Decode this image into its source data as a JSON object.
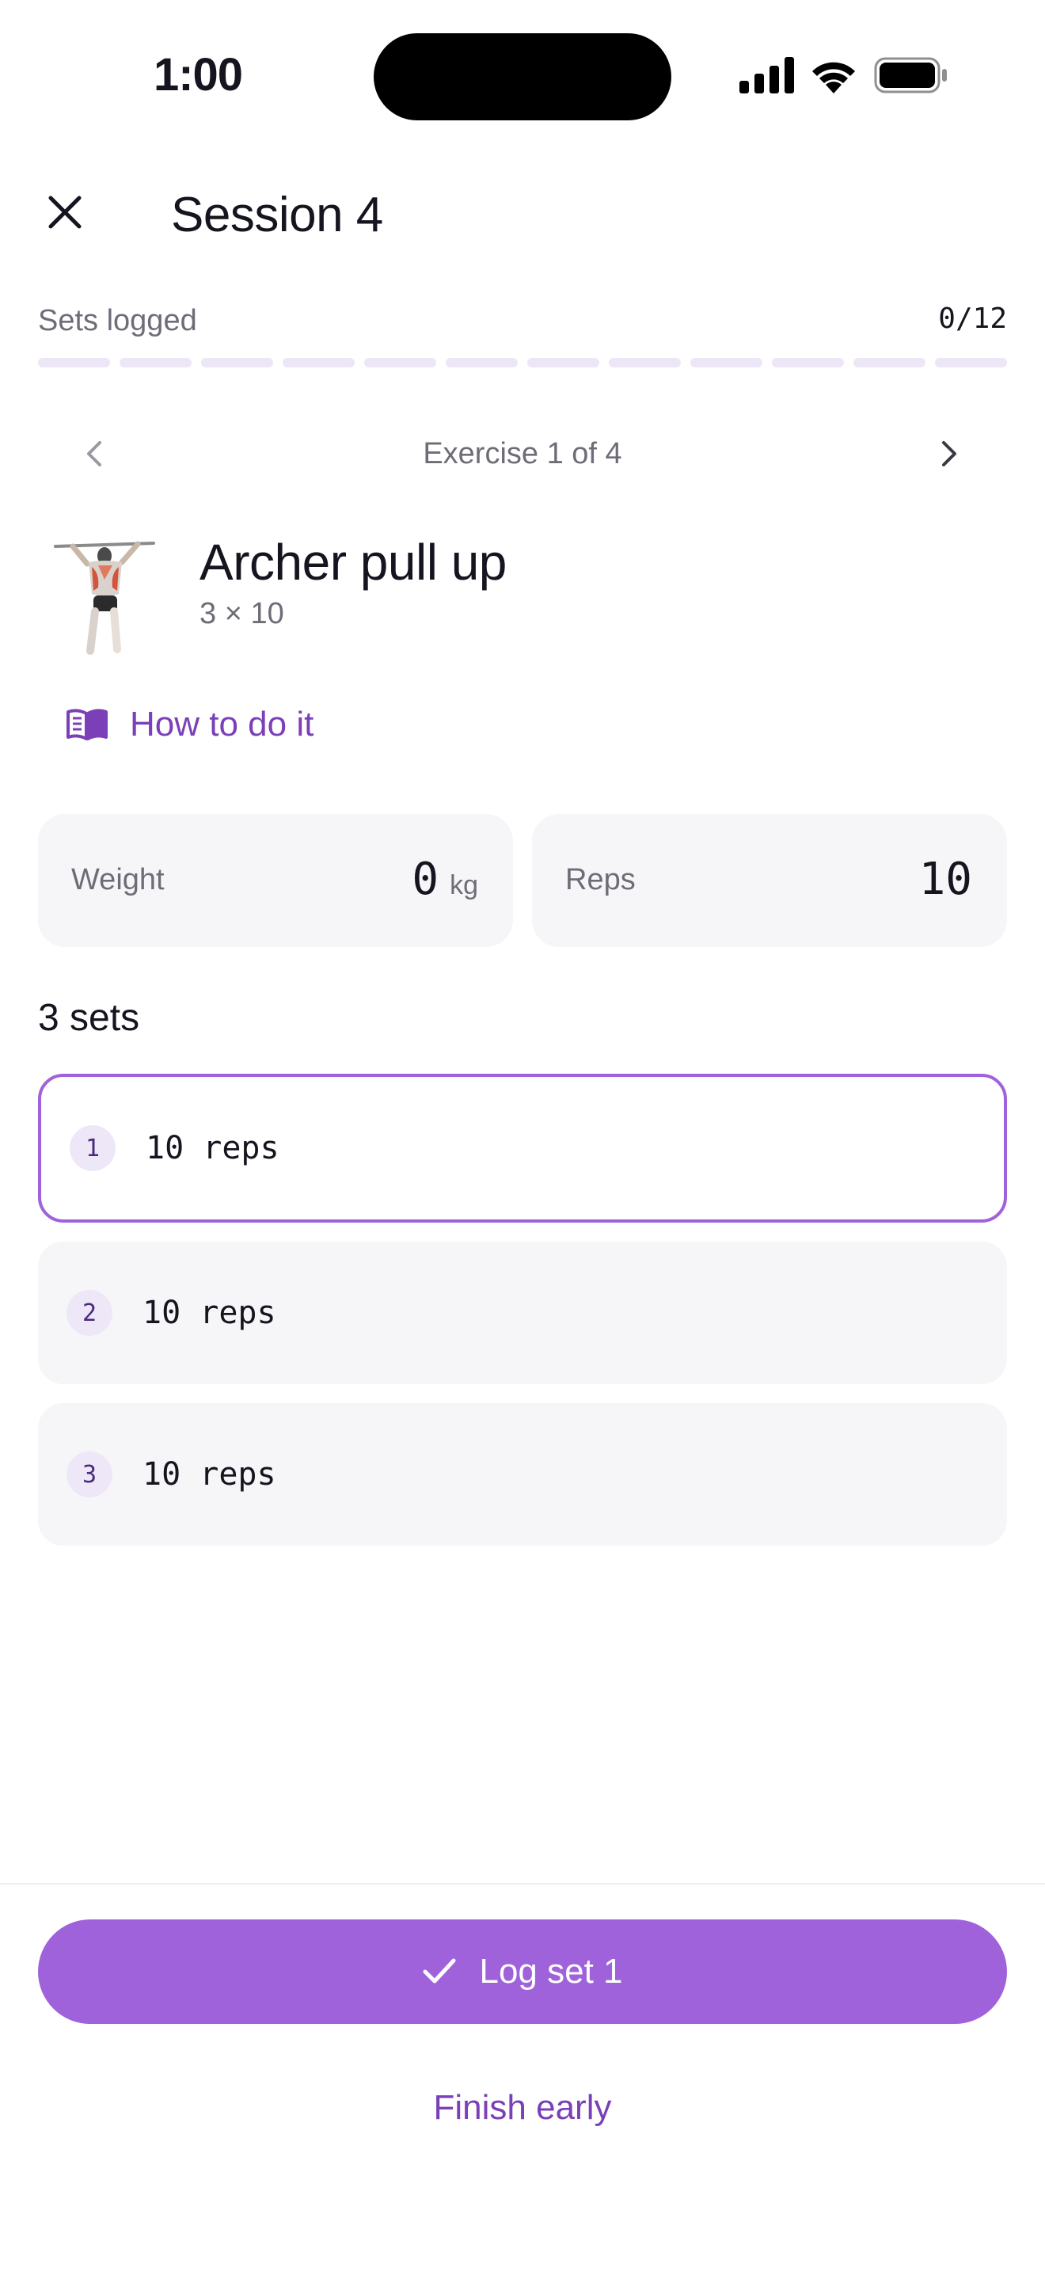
{
  "status_bar": {
    "time": "1:00",
    "icons": [
      "signal-icon",
      "wifi-icon",
      "battery-icon"
    ]
  },
  "header": {
    "close_icon": "close-icon",
    "title": "Session 4"
  },
  "progress": {
    "label": "Sets logged",
    "count": "0/12",
    "logged": 0,
    "total": 12
  },
  "exercise_nav": {
    "prev_icon": "chevron-left-icon",
    "next_icon": "chevron-right-icon",
    "label": "Exercise 1 of 4"
  },
  "exercise": {
    "name": "Archer pull up",
    "scheme": "3 × 10",
    "image": "archer-pull-up-illustration"
  },
  "how_to": {
    "icon": "book-open-icon",
    "label": "How to do it"
  },
  "inputs": {
    "weight": {
      "label": "Weight",
      "value": "0",
      "unit": "kg"
    },
    "reps": {
      "label": "Reps",
      "value": "10"
    }
  },
  "sets": {
    "heading": "3 sets",
    "items": [
      {
        "number": "1",
        "text": "10 reps",
        "active": true
      },
      {
        "number": "2",
        "text": "10 reps",
        "active": false
      },
      {
        "number": "3",
        "text": "10 reps",
        "active": false
      }
    ]
  },
  "footer": {
    "log_icon": "check-icon",
    "log_label": "Log set 1",
    "finish_label": "Finish early"
  },
  "colors": {
    "accent": "#9F62DB",
    "accent_text": "#7B3FB8",
    "card_bg": "#F6F6F8",
    "progress_empty": "#EDE6F6"
  }
}
